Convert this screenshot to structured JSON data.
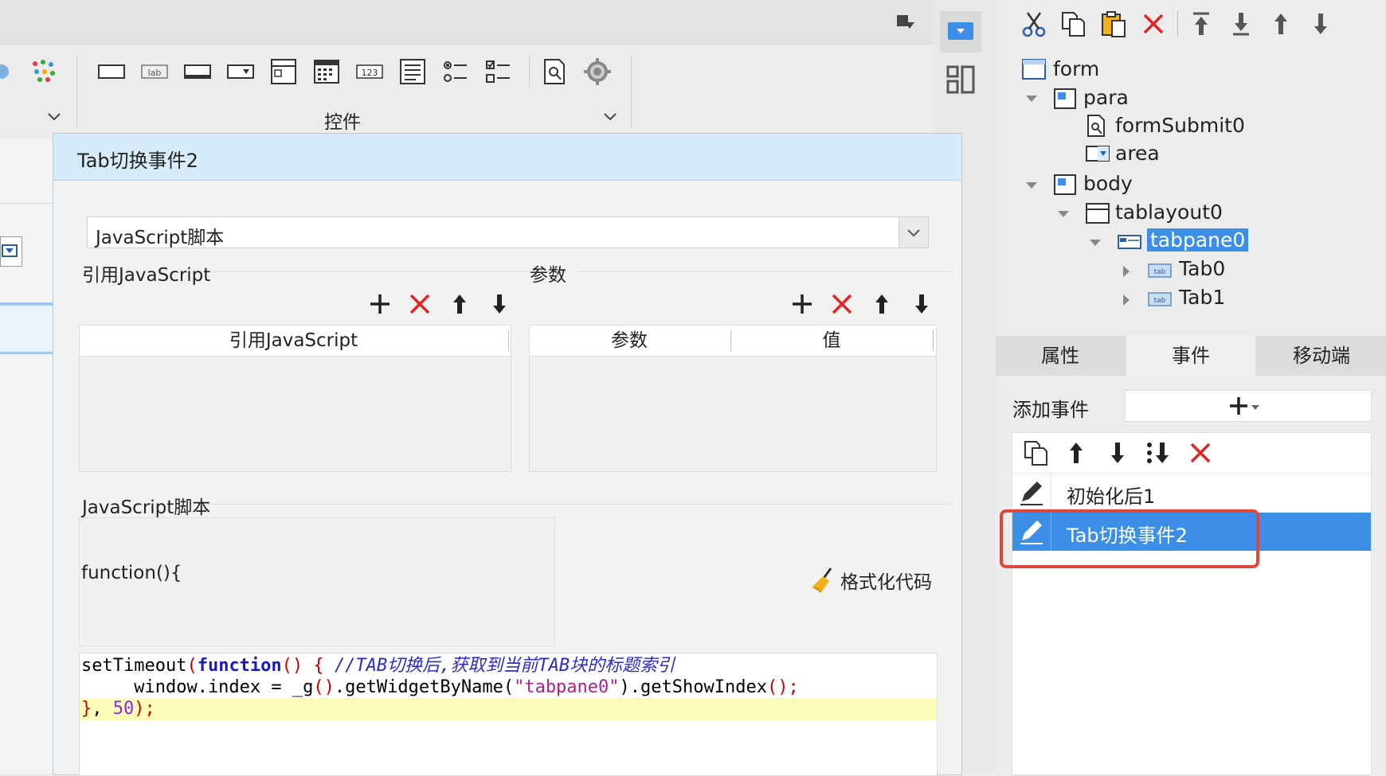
{
  "ribbon": {
    "controls_label": "控件"
  },
  "dialog": {
    "title": "Tab切换事件2",
    "script_type": "JavaScript脚本",
    "ref_js_title": "引用JavaScript",
    "params_title": "参数",
    "ref_js_column": "引用JavaScript",
    "params_columns": [
      "参数",
      "值"
    ],
    "script_title": "JavaScript脚本",
    "function_header": "function(){",
    "format_code_label": "格式化代码",
    "code": {
      "line1_a": "setTimeout",
      "line1_b": "(",
      "line1_c": "function",
      "line1_d": "() { ",
      "line1_comment": "//TAB切换后,获取到当前TAB块的标题索引",
      "line2_a": "     window.index = _g",
      "line2_b": "()",
      "line2_c": ".getWidgetByName(",
      "line2_str": "\"tabpane0\"",
      "line2_d": ").getShowIndex",
      "line2_e": "();",
      "line3_a": "}",
      "line3_b": ", ",
      "line3_num": "50",
      "line3_c": ");"
    }
  },
  "tree": {
    "form": "form",
    "para": "para",
    "formSubmit": "formSubmit0",
    "area": "area",
    "body": "body",
    "tablayout": "tablayout0",
    "tabpane": "tabpane0",
    "tab0": "Tab0",
    "tab1": "Tab1"
  },
  "panel_tabs": [
    "属性",
    "事件",
    "移动端"
  ],
  "events": {
    "add_label": "添加事件",
    "items": [
      "初始化后1",
      "Tab切换事件2"
    ],
    "selected_index": 1
  },
  "colors": {
    "selection": "#3d8ee6",
    "delete_red": "#e02424",
    "highlight_box": "#e2453a",
    "dialog_title_bg": "#d6ecf9"
  }
}
